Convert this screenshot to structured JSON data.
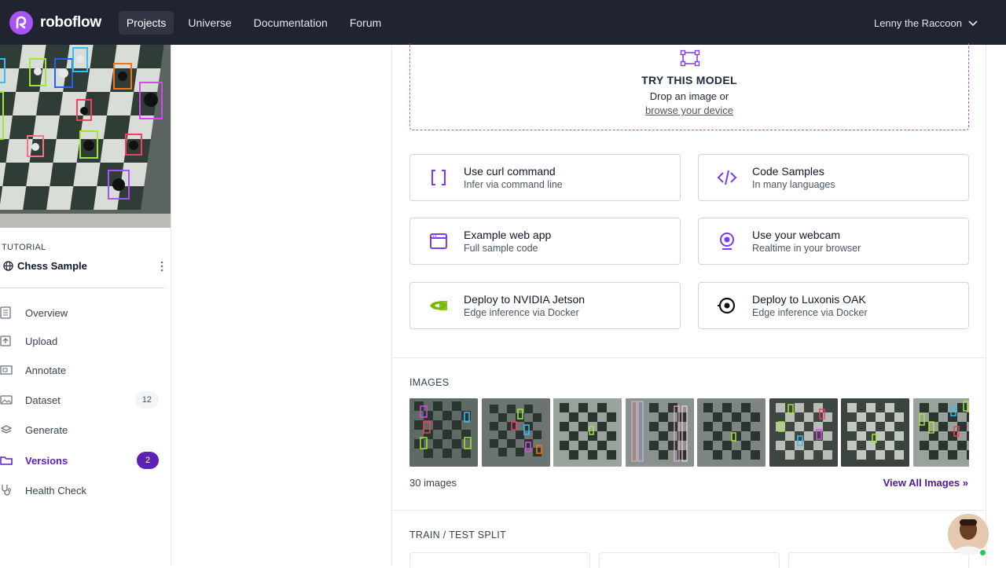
{
  "nav": {
    "brand": "roboflow",
    "links": [
      {
        "label": "Projects",
        "active": true
      },
      {
        "label": "Universe",
        "active": false
      },
      {
        "label": "Documentation",
        "active": false
      },
      {
        "label": "Forum",
        "active": false
      }
    ],
    "user": "Lenny the Raccoon"
  },
  "sidebar": {
    "category": "TUTORIAL",
    "project_name": "Chess Sample",
    "items": [
      {
        "label": "Overview",
        "icon": "document-icon"
      },
      {
        "label": "Upload",
        "icon": "upload-icon"
      },
      {
        "label": "Annotate",
        "icon": "annotate-icon"
      },
      {
        "label": "Dataset",
        "icon": "images-icon",
        "badge": "12"
      },
      {
        "label": "Generate",
        "icon": "layers-icon"
      },
      {
        "label": "Versions",
        "icon": "folder-icon",
        "badge": "2",
        "active": true
      },
      {
        "label": "Health Check",
        "icon": "stethoscope-icon"
      }
    ]
  },
  "try_model": {
    "title": "TRY THIS MODEL",
    "subtitle": "Drop an image or",
    "link": "browse your device"
  },
  "deploy_options": [
    {
      "title": "Use curl command",
      "subtitle": "Infer via command line",
      "icon": "brackets-icon"
    },
    {
      "title": "Code Samples",
      "subtitle": "In many languages",
      "icon": "code-icon"
    },
    {
      "title": "Example web app",
      "subtitle": "Full sample code",
      "icon": "browser-window-icon"
    },
    {
      "title": "Use your webcam",
      "subtitle": "Realtime in your browser",
      "icon": "webcam-icon"
    },
    {
      "title": "Deploy to NVIDIA Jetson",
      "subtitle": "Edge inference via Docker",
      "icon": "nvidia-icon"
    },
    {
      "title": "Deploy to Luxonis OAK",
      "subtitle": "Edge inference via Docker",
      "icon": "luxonis-icon"
    }
  ],
  "images": {
    "label": "IMAGES",
    "count_text": "30 images",
    "view_all": "View All Images »"
  },
  "split": {
    "label": "TRAIN / TEST SPLIT"
  },
  "colors": {
    "accent": "#5b21b6",
    "nav_bg": "#1f2430",
    "brand": "#a855f7"
  }
}
